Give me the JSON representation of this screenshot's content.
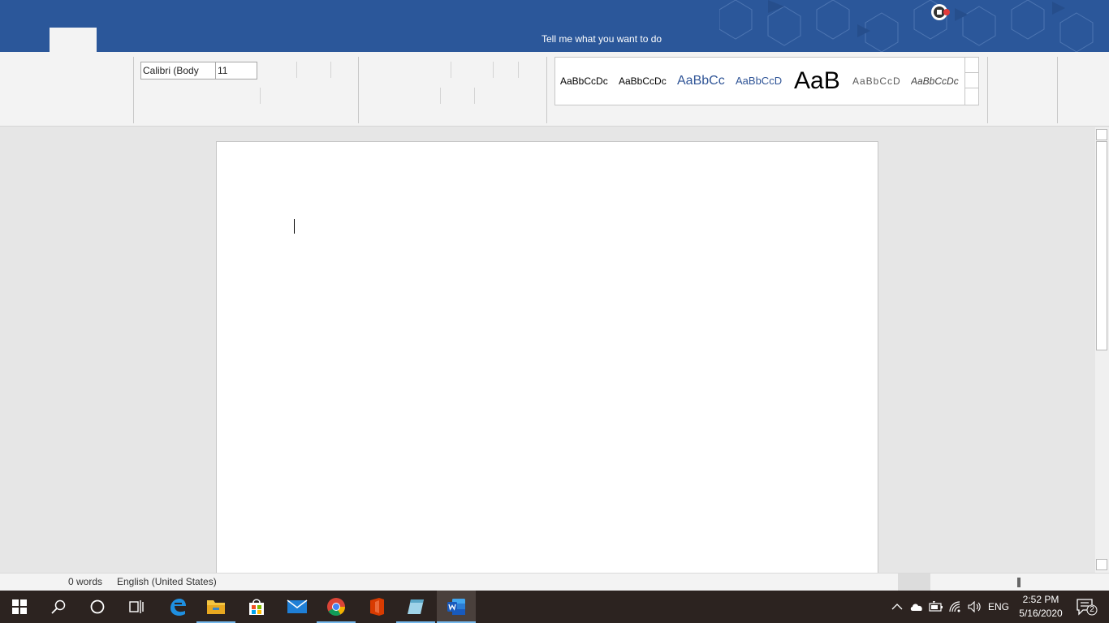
{
  "titlebar": {
    "tell_me": "Tell me what you want to do",
    "background_color": "#2b579a"
  },
  "ribbon": {
    "font_name": "Calibri (Body",
    "font_size": "11",
    "styles": [
      {
        "sample": "AaBbCcDc",
        "color": "#000000"
      },
      {
        "sample": "AaBbCcDc",
        "color": "#000000"
      },
      {
        "sample": "AaBbCc",
        "color": "#2f5496"
      },
      {
        "sample": "AaBbCcD",
        "color": "#2f5496"
      },
      {
        "sample": "AaB",
        "color": "#000000"
      },
      {
        "sample": "AaBbCcD",
        "color": "#595959"
      },
      {
        "sample": "AaBbCcDc",
        "color": "#404040"
      }
    ]
  },
  "status": {
    "word_count": "0 words",
    "language": "English (United States)"
  },
  "taskbar": {
    "apps": [
      "start-icon",
      "search-icon",
      "cortana-icon",
      "task-view-icon",
      "edge-icon",
      "file-explorer-icon",
      "store-icon",
      "mail-icon",
      "chrome-icon",
      "office-icon",
      "notepad-icon",
      "word-icon"
    ],
    "tray": {
      "language": "ENG",
      "time": "2:52 PM",
      "date": "5/16/2020",
      "notification_count": "2"
    }
  }
}
